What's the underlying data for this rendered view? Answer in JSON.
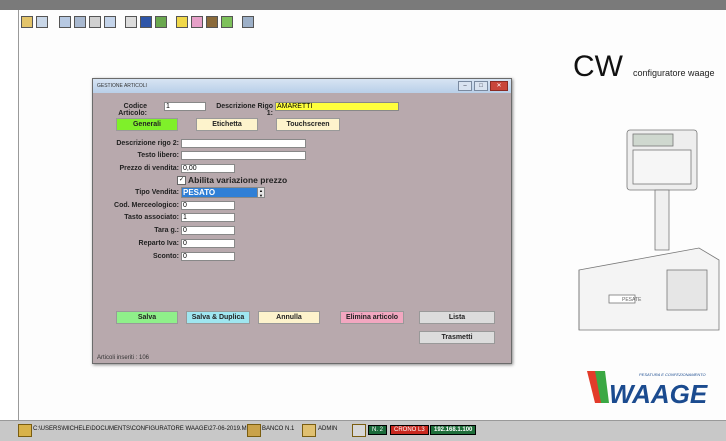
{
  "app": {
    "brand": "CW",
    "brand_subtitle": "configuratore waage",
    "logo_text": "WAAGE",
    "logo_tagline": "PESATURA E CONFEZIONAMENTO",
    "scale_label": "PESATE"
  },
  "dialog": {
    "title": "GESTIONE ARTICOLI",
    "codice_label": "Codice Articolo:",
    "codice_value": "1",
    "desc1_label": "Descrizione Rigo 1:",
    "desc1_value": "AMARETTI",
    "tabs": [
      "Generali",
      "Etichetta",
      "Touchscreen"
    ],
    "fields": {
      "desc2_label": "Descrizione rigo 2:",
      "desc2_value": "",
      "testo_label": "Testo libero:",
      "testo_value": "",
      "prezzo_label": "Prezzo di vendita:",
      "prezzo_value": "0,00",
      "abilita_label": "Abilita variazione prezzo",
      "abilita_checked": true,
      "tipo_label": "Tipo Vendita:",
      "tipo_value": "PESATO",
      "cod_merc_label": "Cod. Merceologico:",
      "cod_merc_value": "0",
      "tasto_label": "Tasto associato:",
      "tasto_value": "1",
      "tara_label": "Tara g.:",
      "tara_value": "0",
      "reparto_label": "Reparto Iva:",
      "reparto_value": "0",
      "sconto_label": "Sconto:",
      "sconto_value": "0"
    },
    "buttons": {
      "salva": "Salva",
      "salva_duplica": "Salva & Duplica",
      "annulla": "Annulla",
      "elimina": "Elimina articolo",
      "lista": "Lista",
      "trasmetti": "Trasmetti"
    },
    "status": "Articoli inseriti : 106"
  },
  "taskbar": {
    "path": "C:\\USERS\\MICHELE\\DOCUMENTS\\CONFIGURATORE WAAGE\\27-06-2019.MDB",
    "banco": "BANCO N.1",
    "user": "ADMIN",
    "n_label": "N. 2",
    "crono": "CRONO L3",
    "ip": "192.168.1.100"
  },
  "colors": {
    "dialog_bg": "#b8a9ad",
    "generali_tab": "#7ff02a",
    "desc1_field": "#ffff3d",
    "salva": "#8ff08a",
    "salva_duplica": "#9fe6f0",
    "annulla": "#fdf3cc",
    "elimina": "#f2a7c0",
    "lista": "#dcdcdc"
  }
}
